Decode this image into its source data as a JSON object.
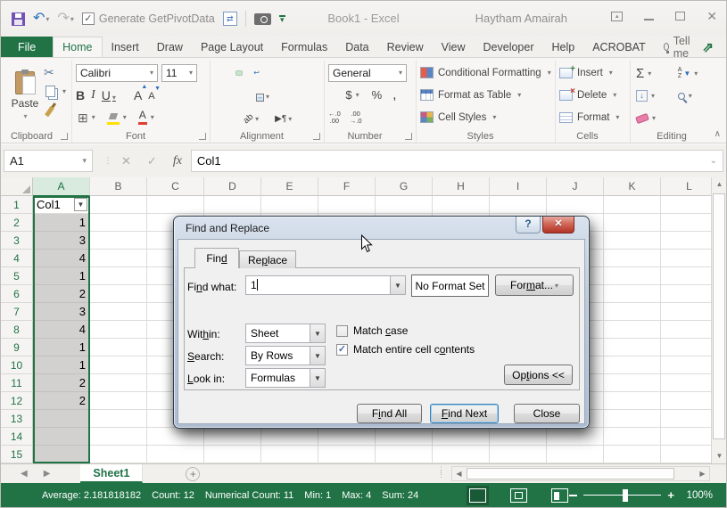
{
  "window": {
    "title": "Book1 - Excel",
    "user": "Haytham Amairah"
  },
  "qat": {
    "generate_getpivotdata": "Generate GetPivotData"
  },
  "ribbon": {
    "tabs": [
      {
        "label": "File",
        "file": true,
        "active": false
      },
      {
        "label": "Home",
        "file": false,
        "active": true
      },
      {
        "label": "Insert",
        "file": false,
        "active": false
      },
      {
        "label": "Draw",
        "file": false,
        "active": false
      },
      {
        "label": "Page Layout",
        "file": false,
        "active": false
      },
      {
        "label": "Formulas",
        "file": false,
        "active": false
      },
      {
        "label": "Data",
        "file": false,
        "active": false
      },
      {
        "label": "Review",
        "file": false,
        "active": false
      },
      {
        "label": "View",
        "file": false,
        "active": false
      },
      {
        "label": "Developer",
        "file": false,
        "active": false
      },
      {
        "label": "Help",
        "file": false,
        "active": false
      },
      {
        "label": "ACROBAT",
        "file": false,
        "active": false
      }
    ],
    "tell_me": "Tell me",
    "paste": "Paste",
    "font_name": "Calibri",
    "font_size": "11",
    "number_format": "General",
    "groups": {
      "clipboard": "Clipboard",
      "font": "Font",
      "alignment": "Alignment",
      "number": "Number",
      "styles": "Styles",
      "cells": "Cells",
      "editing": "Editing"
    },
    "styles_items": [
      "Conditional Formatting",
      "Format as Table",
      "Cell Styles"
    ],
    "cells_items": [
      "Insert",
      "Delete",
      "Format"
    ],
    "glyphs": {
      "bold": "B",
      "italic": "I",
      "underline": "U",
      "grow_font": "A",
      "shrink_font": "A",
      "currency": "$",
      "percent": "%",
      "comma": ",",
      "inc_decimal": "←.0\n.00",
      "dec_decimal": ".00\n→.0",
      "autosum": "Σ",
      "sort_a": "A",
      "sort_z": "Z",
      "cancel": "✕",
      "enter": "✓",
      "fx": "fx"
    }
  },
  "formula": {
    "name_box": "A1",
    "value": "Col1"
  },
  "grid": {
    "columns": [
      "A",
      "B",
      "C",
      "D",
      "E",
      "F",
      "G",
      "H",
      "I",
      "J",
      "K",
      "L"
    ],
    "row_count": 15,
    "selected_column": "A",
    "a1": "Col1",
    "values": [
      1,
      3,
      4,
      1,
      2,
      3,
      4,
      1,
      1,
      2,
      2
    ]
  },
  "sheets": {
    "active": "Sheet1"
  },
  "status": {
    "items": [
      "Average: 2.181818182",
      "Count: 12",
      "Numerical Count: 11",
      "Min: 1",
      "Max: 4",
      "Sum: 24"
    ],
    "zoom_level": "100%"
  },
  "dialog": {
    "title": "Find and Replace",
    "tabs": {
      "find": {
        "pre": "Fin",
        "accel": "d",
        "post": ""
      },
      "replace": {
        "pre": "Re",
        "accel": "p",
        "post": "lace"
      }
    },
    "find_what": {
      "label": {
        "pre": "Fi",
        "accel": "n",
        "post": "d what:"
      },
      "value": "1"
    },
    "no_format": "No Format Set",
    "format_button": {
      "pre": "For",
      "accel": "m",
      "post": "at..."
    },
    "within": {
      "label": {
        "pre": "Wit",
        "accel": "h",
        "post": "in:"
      },
      "value": "Sheet"
    },
    "search": {
      "label": {
        "pre": "",
        "accel": "S",
        "post": "earch:"
      },
      "value": "By Rows"
    },
    "look_in": {
      "label": {
        "pre": "",
        "accel": "L",
        "post": "ook in:"
      },
      "value": "Formulas"
    },
    "match_case": {
      "label": {
        "pre": "Match ",
        "accel": "c",
        "post": "ase"
      },
      "checked": false
    },
    "match_entire": {
      "label": {
        "pre": "Match entire cell c",
        "accel": "o",
        "post": "ntents"
      },
      "checked": true
    },
    "options_button": {
      "pre": "Op",
      "accel": "t",
      "post": "ions <<"
    },
    "find_all": {
      "pre": "F",
      "accel": "i",
      "post": "nd All"
    },
    "find_next": {
      "pre": "",
      "accel": "F",
      "post": "ind Next"
    },
    "close_button": "Close"
  }
}
